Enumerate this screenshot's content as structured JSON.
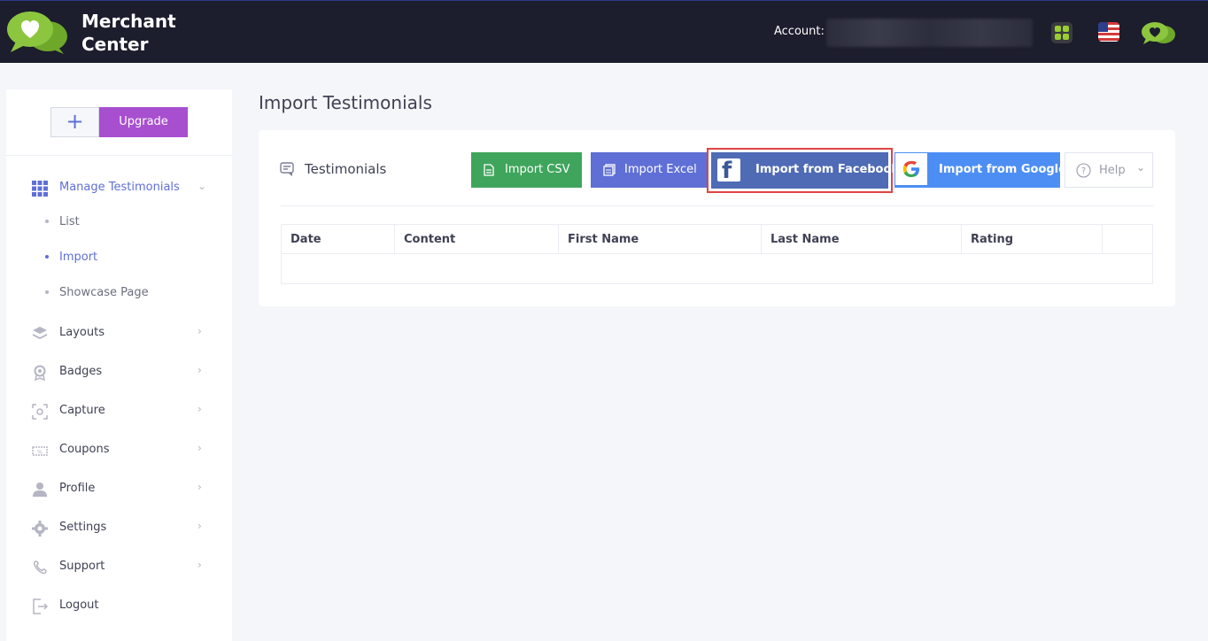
{
  "header": {
    "brand_line1": "Merchant",
    "brand_line2": "Center",
    "account_label": "Account:",
    "icons": [
      "apps-icon",
      "us-flag-icon",
      "logo-icon"
    ]
  },
  "sidebar": {
    "plus_label": "+",
    "upgrade_label": "Upgrade",
    "manage": {
      "label": "Manage Testimonials",
      "icon": "grid-icon"
    },
    "sub_items": [
      {
        "label": "List"
      },
      {
        "label": "Import"
      },
      {
        "label": "Showcase Page"
      }
    ],
    "items": [
      {
        "label": "Layouts",
        "icon": "layers-icon"
      },
      {
        "label": "Badges",
        "icon": "badge-icon"
      },
      {
        "label": "Capture",
        "icon": "capture-icon"
      },
      {
        "label": "Coupons",
        "icon": "coupon-icon"
      },
      {
        "label": "Profile",
        "icon": "user-icon"
      },
      {
        "label": "Settings",
        "icon": "gear-icon"
      },
      {
        "label": "Support",
        "icon": "support-icon"
      },
      {
        "label": "Logout",
        "icon": "logout-icon"
      }
    ]
  },
  "main": {
    "page_title": "Import Testimonials",
    "card_title": "Testimonials",
    "buttons": {
      "csv": "Import CSV",
      "excel": "Import Excel",
      "facebook": "Import from Facebook",
      "google": "Import from Google",
      "help": "Help"
    },
    "table_headers": [
      "Date",
      "Content",
      "First Name",
      "Last Name",
      "Rating",
      ""
    ]
  },
  "colors": {
    "header_bg": "#1c1d2d",
    "accent": "#5f6fd6",
    "upgrade": "#a84fd0",
    "csv": "#3fa55c",
    "facebook": "#4f6bb5",
    "google": "#4d8ef5",
    "highlight": "#e04444",
    "logo_green": "#8cc63f"
  }
}
